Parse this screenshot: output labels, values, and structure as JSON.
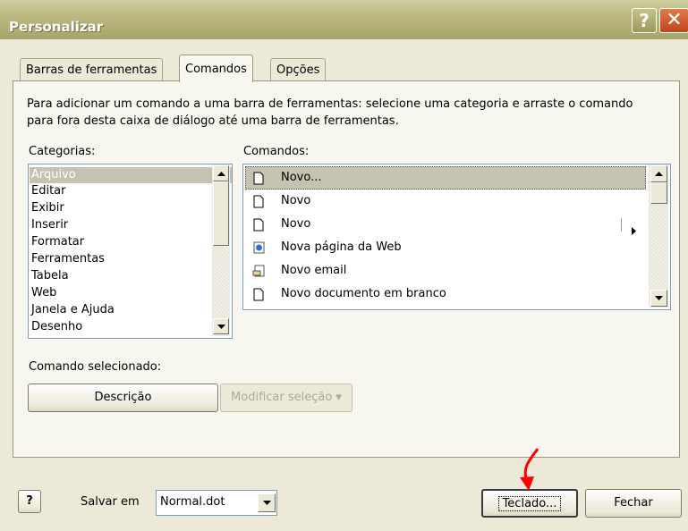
{
  "window": {
    "title": "Personalizar",
    "help_glyph": "?",
    "close_glyph": "✕"
  },
  "tabs": [
    {
      "label": "Barras de ferramentas"
    },
    {
      "label": "Comandos"
    },
    {
      "label": "Opções"
    }
  ],
  "intro": "Para adicionar um comando a uma barra de ferramentas: selecione uma categoria e arraste o comando para fora desta caixa de diálogo até uma barra de ferramentas.",
  "categories": {
    "label": "Categorias:",
    "items": [
      "Arquivo",
      "Editar",
      "Exibir",
      "Inserir",
      "Formatar",
      "Ferramentas",
      "Tabela",
      "Web",
      "Janela e Ajuda",
      "Desenho"
    ],
    "selected": "Arquivo"
  },
  "commands": {
    "label": "Comandos:",
    "items": [
      {
        "label": "Novo...",
        "icon": "blank-document-icon"
      },
      {
        "label": "Novo",
        "icon": "blank-document-icon"
      },
      {
        "label": "Novo",
        "icon": "blank-document-icon",
        "submenu_icon": "submenu-arrow-icon"
      },
      {
        "label": "Nova página da Web",
        "icon": "web-page-icon"
      },
      {
        "label": "Novo email",
        "icon": "email-icon"
      },
      {
        "label": "Novo documento em branco",
        "icon": "blank-document-icon"
      }
    ],
    "selected": "Novo..."
  },
  "selected_command": {
    "label": "Comando selecionado:",
    "description_button": "Descrição",
    "modify_button": "Modificar seleção ▾"
  },
  "footer": {
    "help_icon_glyph": "?",
    "save_in_label": "Salvar em",
    "save_in_value": "Normal.dot",
    "keyboard_button": "Teclado...",
    "close_button": "Fechar"
  },
  "colors": {
    "annotation_arrow": "#ff0000",
    "title_bar": "#b9b67e",
    "selection": "#c5c2b2"
  }
}
